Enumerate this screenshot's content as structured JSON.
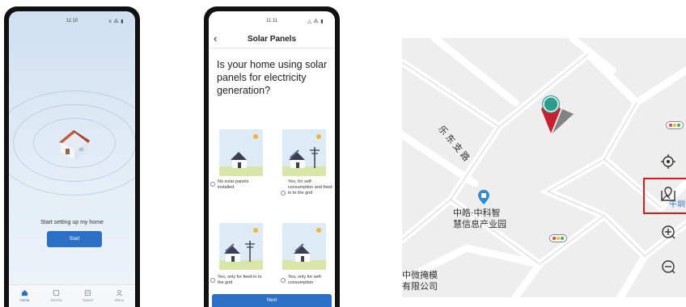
{
  "phone1": {
    "status": {
      "time": "11:10",
      "icons": "ⅹ ⁂ ▮"
    },
    "setup_text": "Start setting up my home",
    "start_label": "Start",
    "tabs": [
      {
        "label": "Home",
        "icon": "home-icon"
      },
      {
        "label": "Device",
        "icon": "device-icon"
      },
      {
        "label": "Report",
        "icon": "report-icon"
      },
      {
        "label": "Menu",
        "icon": "menu-icon"
      }
    ]
  },
  "phone2": {
    "status": {
      "time": "11:11",
      "icons": "△ ⁂ ▮"
    },
    "title": "Solar Panels",
    "question": "Is your home using solar panels for electricity generation?",
    "options": [
      {
        "label": "No solar panels installed"
      },
      {
        "label": "Yes, for self-consumption and feed-in to the grid"
      },
      {
        "label": "Yes, only for feed-in to the grid"
      },
      {
        "label": "Yes, only for self-consumption"
      }
    ],
    "next_label": "Next"
  },
  "map": {
    "road_label": "乐东支路",
    "poi1": {
      "line1": "中皓·中科智",
      "line2": "慧信息产业园"
    },
    "poi2": {
      "line1": "中微掩模",
      "line2": "有限公司"
    },
    "poi3_partial": "午圳诗",
    "tools": [
      "locate-icon",
      "select-area-icon",
      "zoom-in-icon",
      "zoom-out-icon"
    ]
  },
  "colors": {
    "accent": "#2b6fc7",
    "marker_red": "#c8202f",
    "marker_teal": "#2a9d8f",
    "highlight_red": "#d81e1e"
  }
}
